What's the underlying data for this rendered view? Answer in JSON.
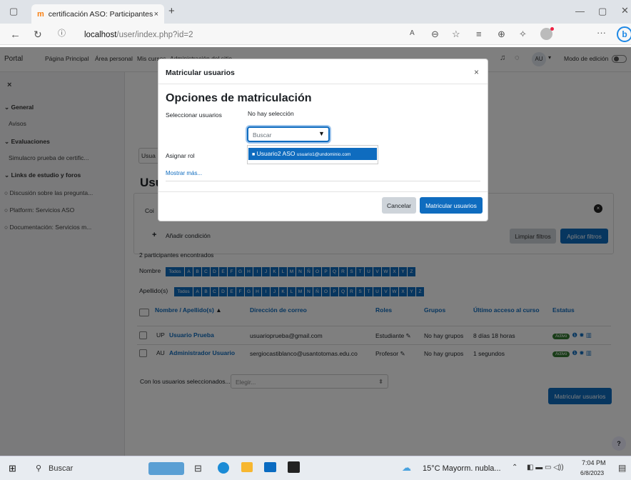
{
  "browser": {
    "tab_title": "certificación ASO: Participantes",
    "tab_favicon": "m",
    "tab_close": "×",
    "new_tab": "+",
    "url_host": "localhost",
    "url_path": "/user/index.php?id=2",
    "profile": "b"
  },
  "navbar": {
    "brand": "Portal",
    "links": [
      "Página Principal",
      "Área personal",
      "Mis cursos",
      "Administración del sitio"
    ],
    "user_initials": "AU",
    "edit_mode": "Modo de edición"
  },
  "sidebar": {
    "close": "×",
    "items": [
      {
        "label": "General",
        "type": "section"
      },
      {
        "label": "Avisos",
        "type": "item"
      },
      {
        "label": "Evaluaciones",
        "type": "section"
      },
      {
        "label": "Simulacro prueba de certific...",
        "type": "item"
      },
      {
        "label": "Links de estudio y foros",
        "type": "section"
      },
      {
        "label": "Discusión sobre las pregunta...",
        "type": "item"
      },
      {
        "label": "Platform: Servicios ASO",
        "type": "item"
      },
      {
        "label": "Documentación: Servicios m...",
        "type": "item"
      }
    ]
  },
  "main": {
    "select_partial": "Usua",
    "heading_partial": "Usu",
    "condition_partial": "Coi",
    "add_condition": "Añadir condición",
    "clear_filters": "Limpiar filtros",
    "apply_filters": "Aplicar filtros",
    "participants_found": "2 participantes encontrados",
    "firstname_label": "Nombre",
    "lastname_label": "Apellido(s)",
    "all_label": "Todos",
    "letters": [
      "A",
      "B",
      "C",
      "D",
      "E",
      "F",
      "G",
      "H",
      "I",
      "J",
      "K",
      "L",
      "M",
      "N",
      "Ñ",
      "O",
      "P",
      "Q",
      "R",
      "S",
      "T",
      "U",
      "V",
      "W",
      "X",
      "Y",
      "Z"
    ],
    "columns": [
      "Nombre / Apellido(s)",
      "Dirección de correo",
      "Roles",
      "Grupos",
      "Último acceso al curso",
      "Estatus"
    ],
    "rows": [
      {
        "initials": "UP",
        "name": "Usuario Prueba",
        "email": "usuarioprueba@gmail.com",
        "role": "Estudiante",
        "groups": "No hay grupos",
        "last_access": "8 días 18 horas",
        "status": "Activo"
      },
      {
        "initials": "AU",
        "name": "Administrador Usuario",
        "email": "sergiocastiblanco@usantotomas.edu.co",
        "role": "Profesor",
        "groups": "No hay grupos",
        "last_access": "1 segundos",
        "status": "Activo"
      }
    ],
    "with_selected": "Con los usuarios seleccionados...",
    "choose": "Elegir...",
    "enrol_button": "Matricular usuarios",
    "help": "?"
  },
  "modal": {
    "title": "Matricular usuarios",
    "close": "×",
    "section_title": "Opciones de matriculación",
    "select_users_label": "Seleccionar usuarios",
    "no_selection": "No hay selección",
    "search_placeholder": "Buscar",
    "suggestion": "Usuario2 ASO",
    "suggestion_email": "usuario1@undominio.com",
    "assign_role_label": "Asignar rol",
    "show_more": "Mostrar más...",
    "cancel": "Cancelar",
    "enrol": "Matricular usuarios"
  },
  "taskbar": {
    "search": "Buscar",
    "weather": "15°C  Mayorm. nubla...",
    "time": "7:04 PM",
    "date": "6/8/2023"
  }
}
